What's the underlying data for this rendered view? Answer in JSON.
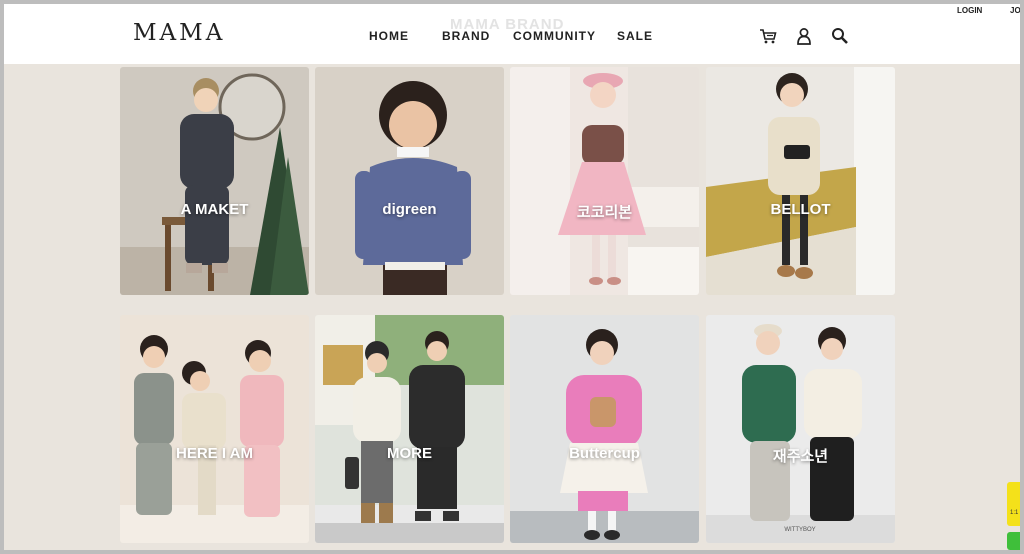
{
  "header": {
    "logo": "MAMA",
    "faded_title": "MAMA BRAND",
    "nav": [
      "HOME",
      "BRAND",
      "COMMUNITY",
      "SALE"
    ],
    "login": "LOGIN",
    "join": "JO",
    "icons": [
      "cart-icon",
      "user-icon",
      "search-icon"
    ]
  },
  "brands": [
    {
      "label": "A MAKET"
    },
    {
      "label": "digreen"
    },
    {
      "label": "코코리본"
    },
    {
      "label": "BELLOT"
    },
    {
      "label": "HERE I AM"
    },
    {
      "label": "MORE"
    },
    {
      "label": "Buttercup"
    },
    {
      "label": "재주소년"
    }
  ],
  "widget": {
    "text": "1:1"
  },
  "watermark": "WITTYBOY"
}
